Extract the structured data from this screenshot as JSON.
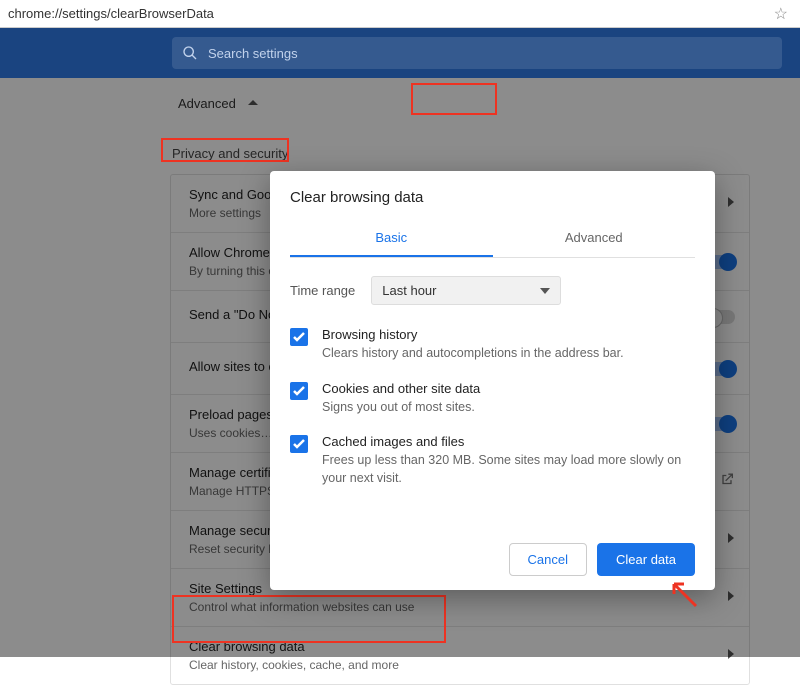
{
  "url": "chrome://settings/clearBrowserData",
  "search_placeholder": "Search settings",
  "advanced_label": "Advanced",
  "section_title": "Privacy and security",
  "rows": [
    {
      "title": "Sync and Google services",
      "sub": "More settings",
      "right": "caret"
    },
    {
      "title": "Allow Chrome sign-in",
      "sub": "By turning this off…",
      "right": "toggle-on"
    },
    {
      "title": "Send a \"Do Not Track\" request",
      "sub": "",
      "right": "toggle-off"
    },
    {
      "title": "Allow sites to check if you have payment methods saved",
      "sub": "",
      "right": "toggle-on"
    },
    {
      "title": "Preload pages for faster browsing and searching",
      "sub": "Uses cookies…",
      "right": "toggle-on"
    },
    {
      "title": "Manage certificates",
      "sub": "Manage HTTPS/SSL certificates",
      "right": "external"
    },
    {
      "title": "Manage security keys",
      "sub": "Reset security keys",
      "right": "caret"
    },
    {
      "title": "Site Settings",
      "sub": "Control what information websites can use",
      "right": "caret"
    },
    {
      "title": "Clear browsing data",
      "sub": "Clear history, cookies, cache, and more",
      "right": "caret"
    }
  ],
  "dialog": {
    "title": "Clear browsing data",
    "tab_basic": "Basic",
    "tab_advanced": "Advanced",
    "range_label": "Time range",
    "range_value": "Last hour",
    "options": [
      {
        "title": "Browsing history",
        "desc": "Clears history and autocompletions in the address bar."
      },
      {
        "title": "Cookies and other site data",
        "desc": "Signs you out of most sites."
      },
      {
        "title": "Cached images and files",
        "desc": "Frees up less than 320 MB. Some sites may load more slowly on your next visit."
      }
    ],
    "cancel": "Cancel",
    "clear": "Clear data"
  }
}
